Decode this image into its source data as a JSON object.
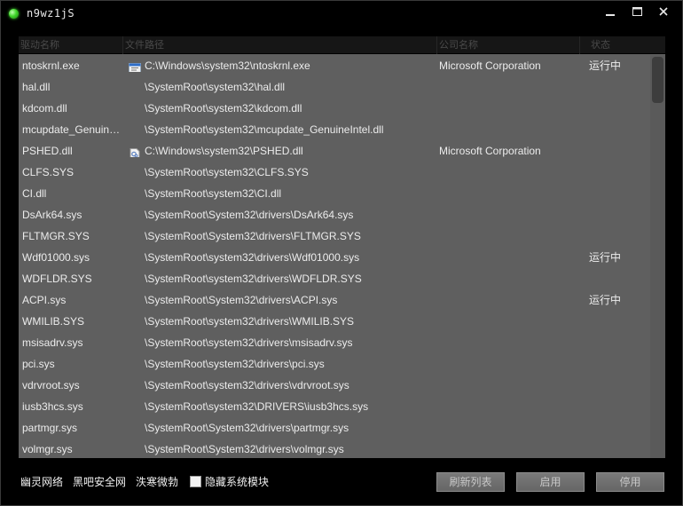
{
  "window": {
    "title": "n9wz1jS"
  },
  "columns": {
    "name": "驱动名称",
    "path": "文件路径",
    "company": "公司名称",
    "status": "状态"
  },
  "rows": [
    {
      "name": "ntoskrnl.exe",
      "icon": "exe",
      "path": "C:\\Windows\\system32\\ntoskrnl.exe",
      "company": "Microsoft Corporation",
      "status": "运行中"
    },
    {
      "name": "hal.dll",
      "icon": "",
      "path": "\\SystemRoot\\system32\\hal.dll",
      "company": "",
      "status": ""
    },
    {
      "name": "kdcom.dll",
      "icon": "",
      "path": "\\SystemRoot\\system32\\kdcom.dll",
      "company": "",
      "status": ""
    },
    {
      "name": "mcupdate_GenuineIntel.dll",
      "icon": "",
      "path": "\\SystemRoot\\system32\\mcupdate_GenuineIntel.dll",
      "company": "",
      "status": ""
    },
    {
      "name": "PSHED.dll",
      "icon": "dll",
      "path": "C:\\Windows\\system32\\PSHED.dll",
      "company": "Microsoft Corporation",
      "status": ""
    },
    {
      "name": "CLFS.SYS",
      "icon": "",
      "path": "\\SystemRoot\\system32\\CLFS.SYS",
      "company": "",
      "status": ""
    },
    {
      "name": "CI.dll",
      "icon": "",
      "path": "\\SystemRoot\\system32\\CI.dll",
      "company": "",
      "status": ""
    },
    {
      "name": "DsArk64.sys",
      "icon": "",
      "path": "\\SystemRoot\\System32\\drivers\\DsArk64.sys",
      "company": "",
      "status": ""
    },
    {
      "name": "FLTMGR.SYS",
      "icon": "",
      "path": "\\SystemRoot\\System32\\drivers\\FLTMGR.SYS",
      "company": "",
      "status": ""
    },
    {
      "name": "Wdf01000.sys",
      "icon": "",
      "path": "\\SystemRoot\\system32\\drivers\\Wdf01000.sys",
      "company": "",
      "status": "运行中"
    },
    {
      "name": "WDFLDR.SYS",
      "icon": "",
      "path": "\\SystemRoot\\system32\\drivers\\WDFLDR.SYS",
      "company": "",
      "status": ""
    },
    {
      "name": "ACPI.sys",
      "icon": "",
      "path": "\\SystemRoot\\System32\\drivers\\ACPI.sys",
      "company": "",
      "status": "运行中"
    },
    {
      "name": "WMILIB.SYS",
      "icon": "",
      "path": "\\SystemRoot\\system32\\drivers\\WMILIB.SYS",
      "company": "",
      "status": ""
    },
    {
      "name": "msisadrv.sys",
      "icon": "",
      "path": "\\SystemRoot\\system32\\drivers\\msisadrv.sys",
      "company": "",
      "status": ""
    },
    {
      "name": "pci.sys",
      "icon": "",
      "path": "\\SystemRoot\\system32\\drivers\\pci.sys",
      "company": "",
      "status": ""
    },
    {
      "name": "vdrvroot.sys",
      "icon": "",
      "path": "\\SystemRoot\\system32\\drivers\\vdrvroot.sys",
      "company": "",
      "status": ""
    },
    {
      "name": "iusb3hcs.sys",
      "icon": "",
      "path": "\\SystemRoot\\system32\\DRIVERS\\iusb3hcs.sys",
      "company": "",
      "status": ""
    },
    {
      "name": "partmgr.sys",
      "icon": "",
      "path": "\\SystemRoot\\System32\\drivers\\partmgr.sys",
      "company": "",
      "status": ""
    },
    {
      "name": "volmgr.sys",
      "icon": "",
      "path": "\\SystemRoot\\System32\\drivers\\volmgr.sys",
      "company": "",
      "status": ""
    }
  ],
  "footer": {
    "link1": "幽灵网络",
    "link2": "黑吧安全网",
    "link3": "泆寒微勃",
    "hide_label": "隐藏系统模块",
    "refresh": "刷新列表",
    "enable": "启用",
    "disable": "停用"
  },
  "colors": {
    "accent": "#3fd62a",
    "list_bg": "#5f5f5f",
    "window_bg": "#000000"
  }
}
